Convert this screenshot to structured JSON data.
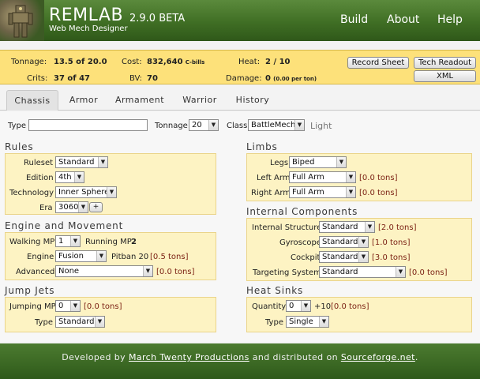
{
  "header": {
    "brand": "REMLAB",
    "version": "2.9.0 BETA",
    "tagline": "Web Mech Designer",
    "nav": [
      "Build",
      "About",
      "Help"
    ]
  },
  "summary": {
    "tonnage_label": "Tonnage:",
    "tonnage_value": "13.5 of 20.0",
    "crits_label": "Crits:",
    "crits_value": "37 of 47",
    "cost_label": "Cost:",
    "cost_value": "832,640",
    "cost_unit": "C-bills",
    "bv_label": "BV:",
    "bv_value": "70",
    "heat_label": "Heat:",
    "heat_value": "2 / 10",
    "damage_label": "Damage:",
    "damage_value": "0",
    "damage_unit": "(0.00 per ton)",
    "buttons": {
      "record_sheet": "Record Sheet",
      "tech_readout": "Tech Readout",
      "xml": "XML"
    }
  },
  "tabs": [
    "Chassis",
    "Armor",
    "Armament",
    "Warrior",
    "History"
  ],
  "top_row": {
    "type_label": "Type",
    "type_value": "",
    "tonnage_label": "Tonnage",
    "tonnage_value": "20",
    "class_label": "Class",
    "class_value": "BattleMech",
    "class_weight": "Light"
  },
  "rules": {
    "title": "Rules",
    "ruleset_label": "Ruleset",
    "ruleset_value": "Standard",
    "edition_label": "Edition",
    "edition_value": "4th",
    "technology_label": "Technology",
    "technology_value": "Inner Sphere",
    "era_label": "Era",
    "era_value": "3060",
    "era_button": "+"
  },
  "engine": {
    "title": "Engine and Movement",
    "walking_label": "Walking MP",
    "walking_value": "1",
    "running_label": "Running MP",
    "running_value": "2",
    "engine_label": "Engine",
    "engine_value": "Fusion",
    "engine_name": "Pitban 20",
    "engine_tons": "[0.5 tons]",
    "advanced_label": "Advanced",
    "advanced_value": "None",
    "advanced_tons": "[0.0 tons]"
  },
  "jump": {
    "title": "Jump Jets",
    "jumping_label": "Jumping MP",
    "jumping_value": "0",
    "jumping_tons": "[0.0 tons]",
    "type_label": "Type",
    "type_value": "Standard"
  },
  "limbs": {
    "title": "Limbs",
    "legs_label": "Legs",
    "legs_value": "Biped",
    "left_arm_label": "Left Arm",
    "left_arm_value": "Full Arm",
    "left_arm_tons": "[0.0 tons]",
    "right_arm_label": "Right Arm",
    "right_arm_value": "Full Arm",
    "right_arm_tons": "[0.0 tons]"
  },
  "internal": {
    "title": "Internal Components",
    "structure_label": "Internal Structure",
    "structure_value": "Standard",
    "structure_tons": "[2.0 tons]",
    "gyro_label": "Gyroscope",
    "gyro_value": "Standard",
    "gyro_tons": "[1.0 tons]",
    "cockpit_label": "Cockpit",
    "cockpit_value": "Standard",
    "cockpit_tons": "[3.0 tons]",
    "targeting_label": "Targeting System",
    "targeting_value": "Standard",
    "targeting_tons": "[0.0 tons]"
  },
  "heat_sinks": {
    "title": "Heat Sinks",
    "quantity_label": "Quantity",
    "quantity_value": "0",
    "quantity_extra": "+10",
    "quantity_tons": "[0.0 tons]",
    "type_label": "Type",
    "type_value": "Single"
  },
  "footer": {
    "prefix": "Developed by ",
    "link1": "March Twenty Productions",
    "middle": " and distributed on ",
    "link2": "Sourceforge.net",
    "suffix": "."
  },
  "colors": {
    "header_green": "#3f6e24",
    "summary_yellow": "#fde17a",
    "panel_yellow": "#fdf3c3",
    "tons_red": "#7a1f12"
  }
}
